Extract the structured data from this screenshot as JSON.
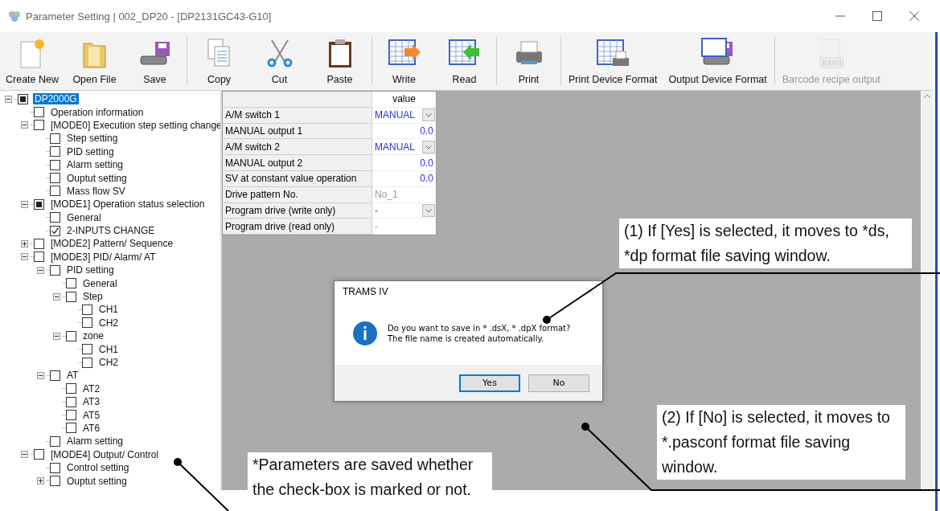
{
  "window": {
    "title": "Parameter Setting  | 002_DP20 - [DP2131GC43-G10]"
  },
  "toolbar": [
    {
      "kind": "button",
      "label": "Create New",
      "disabled": false
    },
    {
      "kind": "button",
      "label": "Open File",
      "disabled": false
    },
    {
      "kind": "button",
      "label": "Save",
      "disabled": false
    },
    {
      "kind": "separator"
    },
    {
      "kind": "button",
      "label": "Copy",
      "disabled": false
    },
    {
      "kind": "button",
      "label": "Cut",
      "disabled": false
    },
    {
      "kind": "button",
      "label": "Paste",
      "disabled": false
    },
    {
      "kind": "separator"
    },
    {
      "kind": "button",
      "label": "Write",
      "disabled": false
    },
    {
      "kind": "button",
      "label": "Read",
      "disabled": false
    },
    {
      "kind": "separator"
    },
    {
      "kind": "button",
      "label": "Print",
      "disabled": false
    },
    {
      "kind": "separator"
    },
    {
      "kind": "button",
      "label": "Print Device Format",
      "disabled": false
    },
    {
      "kind": "button",
      "label": "Output Device Format",
      "disabled": false
    },
    {
      "kind": "separator"
    },
    {
      "kind": "button",
      "label": "Barcode recipe output",
      "disabled": true
    }
  ],
  "tree": [
    {
      "label": "DP2000G",
      "checked": false,
      "partial": true,
      "selected": true,
      "expanded": true,
      "children": [
        {
          "label": "Operation information",
          "checked": false,
          "partial": false,
          "selected": false
        },
        {
          "label": "[MODE0] Execution step setting change",
          "checked": false,
          "partial": false,
          "selected": false,
          "expanded": true,
          "children": [
            {
              "label": "Step setting",
              "checked": false,
              "partial": false,
              "selected": false
            },
            {
              "label": "PID setting",
              "checked": false,
              "partial": false,
              "selected": false
            },
            {
              "label": "Alarm setting",
              "checked": false,
              "partial": false,
              "selected": false
            },
            {
              "label": "Ouptut setting",
              "checked": false,
              "partial": false,
              "selected": false
            },
            {
              "label": "Mass flow SV",
              "checked": false,
              "partial": false,
              "selected": false
            }
          ]
        },
        {
          "label": "[MODE1] Operation status selection",
          "checked": false,
          "partial": true,
          "selected": false,
          "expanded": true,
          "children": [
            {
              "label": "General",
              "checked": false,
              "partial": false,
              "selected": false
            },
            {
              "label": "2-INPUTS CHANGE",
              "checked": true,
              "partial": false,
              "selected": false
            }
          ]
        },
        {
          "label": "[MODE2] Pattern/ Sequence",
          "checked": false,
          "partial": false,
          "selected": false,
          "expanded": false
        },
        {
          "label": "[MODE3] PID/ Alarm/ AT",
          "checked": false,
          "partial": false,
          "selected": false,
          "expanded": true,
          "children": [
            {
              "label": "PID setting",
              "checked": false,
              "partial": false,
              "selected": false,
              "expanded": true,
              "children": [
                {
                  "label": "General",
                  "checked": false,
                  "partial": false,
                  "selected": false
                },
                {
                  "label": "Step",
                  "checked": false,
                  "partial": false,
                  "selected": false,
                  "expanded": true,
                  "children": [
                    {
                      "label": "CH1",
                      "checked": false,
                      "partial": false,
                      "selected": false
                    },
                    {
                      "label": "CH2",
                      "checked": false,
                      "partial": false,
                      "selected": false
                    }
                  ]
                },
                {
                  "label": "zone",
                  "checked": false,
                  "partial": false,
                  "selected": false,
                  "expanded": true,
                  "children": [
                    {
                      "label": "CH1",
                      "checked": false,
                      "partial": false,
                      "selected": false
                    },
                    {
                      "label": "CH2",
                      "checked": false,
                      "partial": false,
                      "selected": false
                    }
                  ]
                }
              ]
            },
            {
              "label": "AT",
              "checked": false,
              "partial": false,
              "selected": false,
              "expanded": true,
              "children": [
                {
                  "label": "AT2",
                  "checked": false,
                  "partial": false,
                  "selected": false
                },
                {
                  "label": "AT3",
                  "checked": false,
                  "partial": false,
                  "selected": false
                },
                {
                  "label": "AT5",
                  "checked": false,
                  "partial": false,
                  "selected": false
                },
                {
                  "label": "AT6",
                  "checked": false,
                  "partial": false,
                  "selected": false
                }
              ]
            },
            {
              "label": "Alarm setting",
              "checked": false,
              "partial": false,
              "selected": false
            }
          ]
        },
        {
          "label": "[MODE4] Output/ Control",
          "checked": false,
          "partial": false,
          "selected": false,
          "expanded": true,
          "children": [
            {
              "label": "Control setting",
              "checked": false,
              "partial": false,
              "selected": false
            },
            {
              "label": "Ouptut setting",
              "checked": false,
              "partial": false,
              "selected": false,
              "expanded": false
            }
          ]
        }
      ]
    }
  ],
  "grid": {
    "header": "value",
    "rows": [
      {
        "name": "A/M switch 1",
        "value": "MANUAL",
        "kind": "dropdown"
      },
      {
        "name": "MANUAL output 1",
        "value": "0.0",
        "kind": "number"
      },
      {
        "name": "A/M switch 2",
        "value": "MANUAL",
        "kind": "dropdown"
      },
      {
        "name": "MANUAL output 2",
        "value": "0.0",
        "kind": "number"
      },
      {
        "name": "SV at constant value operation",
        "value": "0.0",
        "kind": "number"
      },
      {
        "name": "Drive pattern No.",
        "value": "No_1",
        "kind": "readonly"
      },
      {
        "name": "Program drive (write only)",
        "value": "-",
        "kind": "dropdown"
      },
      {
        "name": "Program drive (read only)",
        "value": "-",
        "kind": "readonly"
      }
    ]
  },
  "dialog": {
    "title": "TRAMS IV",
    "message": [
      "Do you want to save in * .dsX, * .dpX format?",
      "The file name is created automatically."
    ],
    "buttons": [
      {
        "label": "Yes",
        "selected": true
      },
      {
        "label": "No",
        "selected": false
      }
    ]
  },
  "annotations": [
    {
      "text": "(1) If [Yes] is selected, it moves to *ds, *dp format file saving window."
    },
    {
      "text": "(2) If [No] is selected, it moves to *.pasconf format file saving window."
    },
    {
      "text": "*Parameters are saved whether the check-box is marked or not."
    }
  ]
}
